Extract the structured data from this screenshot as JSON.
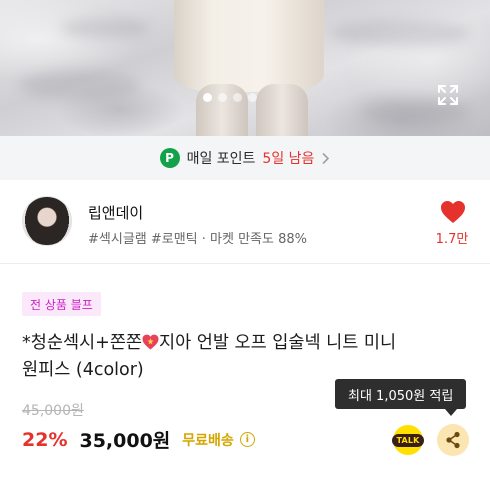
{
  "hero": {
    "slide_count": 4,
    "active_slide": 1,
    "expand_icon": "expand-icon"
  },
  "point_banner": {
    "badge": "P",
    "text": "매일 포인트",
    "highlight": "5일 남음",
    "accent_color": "#12a34a"
  },
  "shop": {
    "name": "립앤데이",
    "tags": "#섹시글램 #로맨틱 · 마켓 만족도 88%",
    "like_count": "1.7만",
    "like_icon": "heart-icon",
    "like_color": "#e5322d"
  },
  "product": {
    "promo_badge": "전 상품 블프",
    "title_part1": "*청순섹시+쫀쫀",
    "title_part2": "지아 언발 오프 입술넥 니트 미니",
    "title_line2": "원피스 (4color)",
    "original_price": "45,000원",
    "discount": "22%",
    "price": "35,000원",
    "shipping": "무료배송",
    "info_icon": "i"
  },
  "tooltip": {
    "text": "최대 1,050원 적립"
  },
  "actions": {
    "talk_label": "TALK",
    "share_icon": "share-icon"
  }
}
